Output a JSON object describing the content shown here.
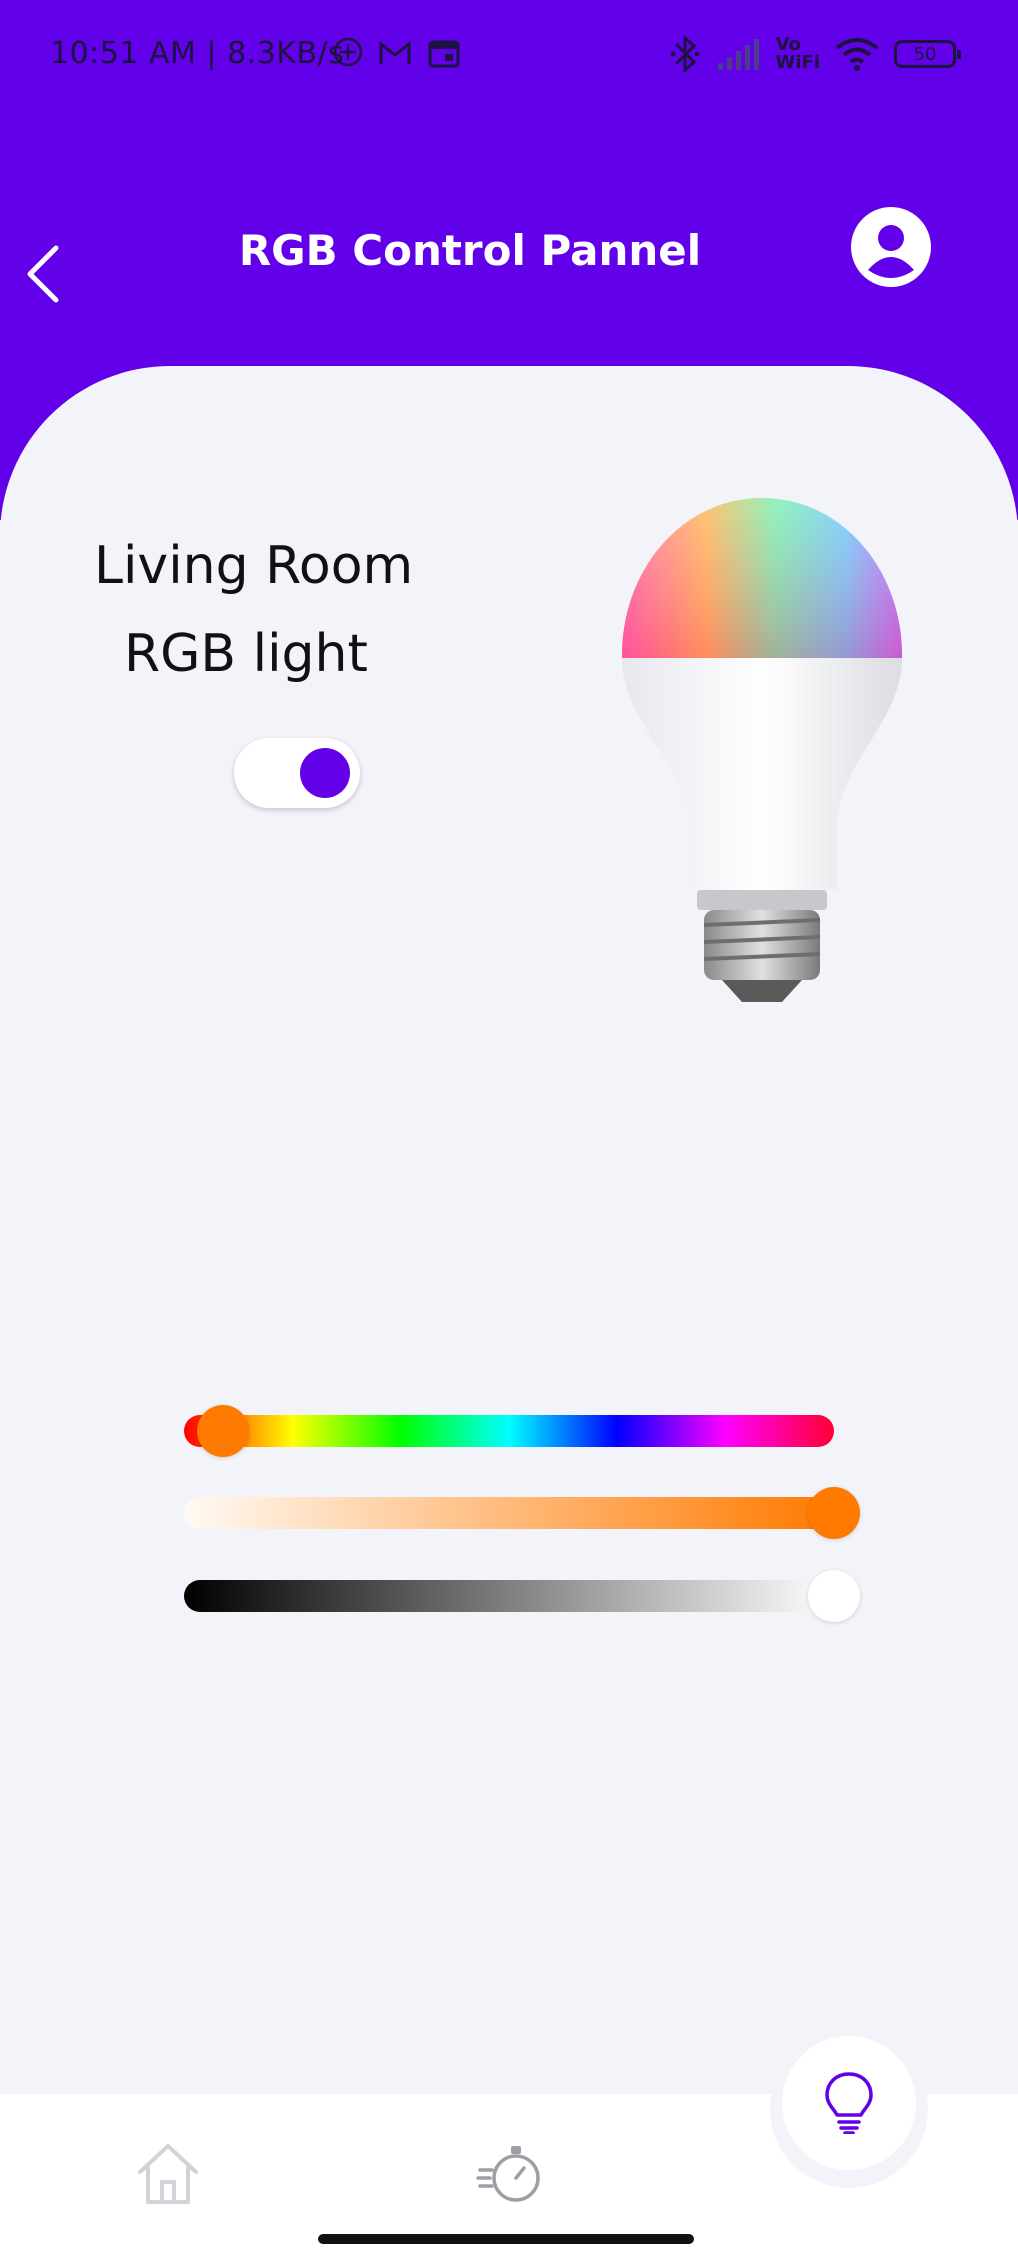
{
  "status_bar": {
    "text": "10:51 AM | 8.3KB/s",
    "battery": "50",
    "vowifi_top": "Vo",
    "vowifi_bottom": "WiFi",
    "icons": [
      "location-icon",
      "gmail-icon",
      "calendar-icon",
      "bluetooth-icon",
      "signal-icon",
      "vowifi-icon",
      "wifi-icon",
      "battery-icon"
    ]
  },
  "header": {
    "title": "RGB Control Pannel",
    "back_icon": "chevron-left-icon",
    "profile_icon": "account-circle-icon"
  },
  "device": {
    "room": "Living Room",
    "name": "RGB light",
    "power_on": true
  },
  "sliders": {
    "hue": {
      "value": 0.06,
      "thumb_color": "#ff7a00"
    },
    "saturation": {
      "value": 1.0,
      "thumb_color": "#ff7a00"
    },
    "brightness": {
      "value": 1.0,
      "thumb_color": "#ffffff"
    }
  },
  "bottom_nav": {
    "items": [
      {
        "icon": "home-icon",
        "active": false
      },
      {
        "icon": "timer-icon",
        "active": false
      },
      {
        "icon": "lightbulb-icon",
        "active": true
      }
    ]
  },
  "colors": {
    "primary": "#6200ea",
    "background": "#f3f4fa",
    "inactive_icon": "#c9c9cf"
  }
}
